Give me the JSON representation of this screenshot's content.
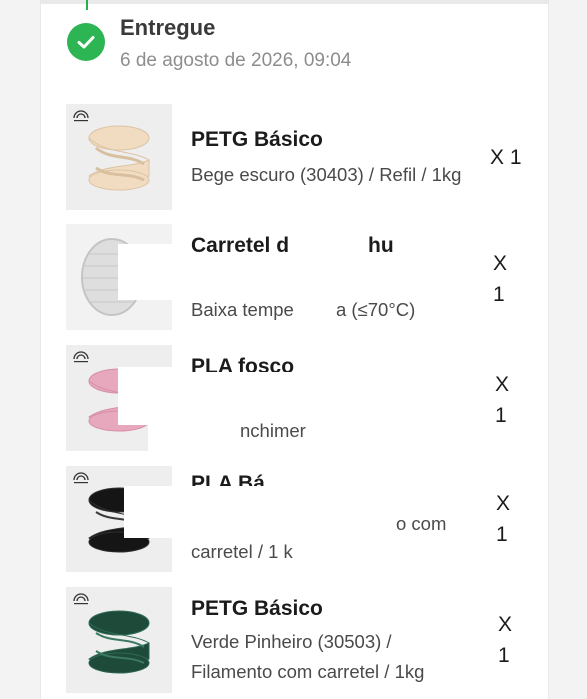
{
  "order": {
    "status": "Entregue",
    "date": "6 de agosto de 2026, 09:04"
  },
  "items": [
    {
      "name": "PETG Básico",
      "variant_line1": "Bege escuro (30403) / Refil / 1kg",
      "variant_line2": "",
      "qty_prefix": "X",
      "qty_value": "1",
      "color": "#f1dcc2"
    },
    {
      "name": "Carretel d",
      "name_tail": "hu",
      "variant_line1": "Baixa tempe",
      "variant_tail": "a (≤70°C)",
      "qty_prefix": "X",
      "qty_value": "1",
      "color": "#d9d9d9"
    },
    {
      "name": "PLA fosco",
      "variant_line1": "nchimer",
      "qty_prefix": "X",
      "qty_value": "1",
      "color": "#e7a7bd"
    },
    {
      "name": "PLA Bá",
      "variant_line1": "o com",
      "variant_line2": "carretel / 1 k",
      "qty_prefix": "X",
      "qty_value": "1",
      "color": "#151515"
    },
    {
      "name": "PETG Básico",
      "variant_line1": "Verde Pinheiro (30503) /",
      "variant_line2": "Filamento com carretel / 1kg",
      "qty_prefix": "X",
      "qty_value": "1",
      "color": "#1e4a3a"
    }
  ]
}
